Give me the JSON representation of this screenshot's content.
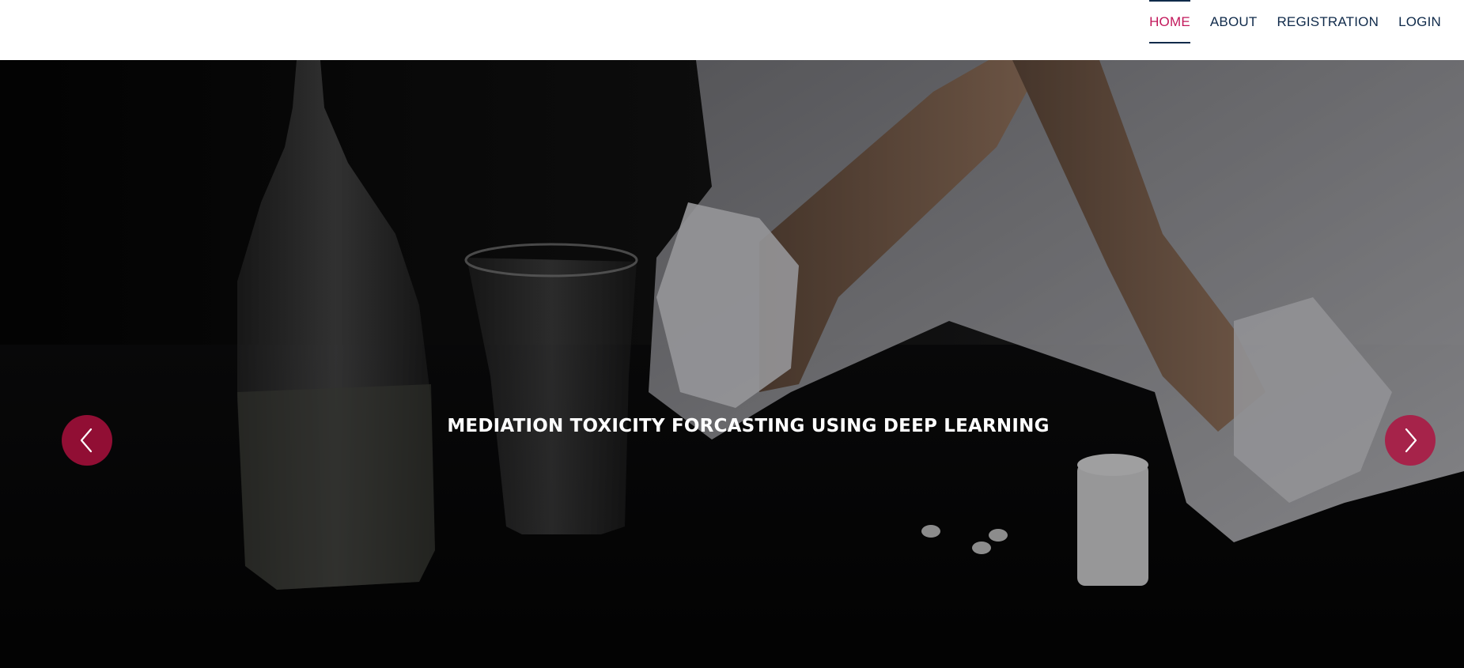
{
  "nav": {
    "items": [
      {
        "label": "HOME",
        "active": true
      },
      {
        "label": "ABOUT",
        "active": false
      },
      {
        "label": "REGISTRATION",
        "active": false
      },
      {
        "label": "LOGIN",
        "active": false
      }
    ]
  },
  "hero": {
    "title": "MEDIATION TOXICITY FORCASTING USING DEEP LEARNING",
    "prev_icon": "chevron-left-icon",
    "next_icon": "chevron-right-icon"
  },
  "colors": {
    "nav_text": "#0f2a4a",
    "nav_active": "#c2185b",
    "arrow_bg": "#b0103e"
  }
}
